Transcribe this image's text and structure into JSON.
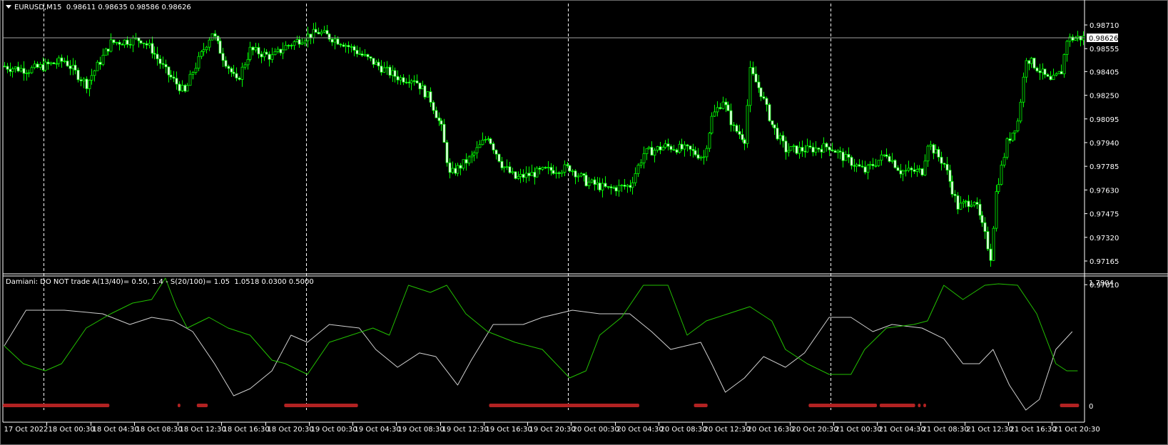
{
  "header": {
    "symbol": "EURUSD,M15",
    "ohlc": "0.98611 0.98635 0.98586 0.98626"
  },
  "indicator": {
    "label": "Damiani: DO NOT trade A(13/40)= 0.50, 1.4 - S(20/100)= 1.05  1.0518 0.0300 0.5000",
    "max_label": "1.7904",
    "zero_label": "0"
  },
  "colors": {
    "candle": "#00ff00",
    "bear_body": "#ffffff",
    "bull_body": "#000000",
    "green_line": "#22c000",
    "white_line": "#d0d0d0",
    "signal": "#b22222",
    "grid": "#c0c0c0"
  },
  "chart_data": {
    "type": "candlestick",
    "bars": 396,
    "timeframe": "M15",
    "price_axis": {
      "range": [
        0.9701,
        0.9871
      ],
      "ticks": [
        "0.98710",
        "0.98555",
        "0.98405",
        "0.98250",
        "0.98095",
        "0.97940",
        "0.97785",
        "0.97630",
        "0.97475",
        "0.97320",
        "0.97165",
        "0.97010"
      ],
      "current": "0.98626"
    },
    "time_axis": {
      "every_bars": 16,
      "labels": [
        "17 Oct 2022",
        "18 Oct 00:30",
        "18 Oct 04:30",
        "18 Oct 08:30",
        "18 Oct 12:30",
        "18 Oct 16:30",
        "18 Oct 20:30",
        "19 Oct 00:30",
        "19 Oct 04:30",
        "19 Oct 08:30",
        "19 Oct 12:30",
        "19 Oct 16:30",
        "19 Oct 20:30",
        "20 Oct 00:30",
        "20 Oct 04:30",
        "20 Oct 08:30",
        "20 Oct 12:30",
        "20 Oct 16:30",
        "20 Oct 20:30",
        "21 Oct 00:30",
        "21 Oct 04:30",
        "21 Oct 08:30",
        "21 Oct 12:30",
        "21 Oct 16:30",
        "21 Oct 20:30"
      ]
    },
    "day_separators_bar": [
      14,
      110,
      206,
      302
    ],
    "close_keypoints": [
      [
        0,
        0.9844
      ],
      [
        2,
        0.9843
      ],
      [
        9,
        0.98416
      ],
      [
        22,
        0.98477
      ],
      [
        30,
        0.98322
      ],
      [
        39,
        0.98593
      ],
      [
        50,
        0.98617
      ],
      [
        54,
        0.98547
      ],
      [
        59,
        0.98406
      ],
      [
        66,
        0.98266
      ],
      [
        69,
        0.98406
      ],
      [
        76,
        0.98663
      ],
      [
        80,
        0.985
      ],
      [
        85,
        0.98336
      ],
      [
        90,
        0.98547
      ],
      [
        98,
        0.985
      ],
      [
        103,
        0.9857
      ],
      [
        111,
        0.9864
      ],
      [
        115,
        0.98663
      ],
      [
        124,
        0.98593
      ],
      [
        132,
        0.985
      ],
      [
        140,
        0.98406
      ],
      [
        145,
        0.9836
      ],
      [
        150,
        0.9836
      ],
      [
        156,
        0.9822
      ],
      [
        160,
        0.98033
      ],
      [
        163,
        0.97729
      ],
      [
        171,
        0.97846
      ],
      [
        177,
        0.97986
      ],
      [
        182,
        0.97799
      ],
      [
        187,
        0.97706
      ],
      [
        197,
        0.97753
      ],
      [
        207,
        0.97776
      ],
      [
        213,
        0.97683
      ],
      [
        221,
        0.97636
      ],
      [
        229,
        0.97659
      ],
      [
        234,
        0.97869
      ],
      [
        242,
        0.97916
      ],
      [
        250,
        0.97893
      ],
      [
        256,
        0.97846
      ],
      [
        259,
        0.98103
      ],
      [
        263,
        0.9822
      ],
      [
        267,
        0.98033
      ],
      [
        271,
        0.97963
      ],
      [
        273,
        0.98406
      ],
      [
        277,
        0.98266
      ],
      [
        281,
        0.98056
      ],
      [
        286,
        0.97893
      ],
      [
        294,
        0.97893
      ],
      [
        302,
        0.97916
      ],
      [
        307,
        0.97846
      ],
      [
        315,
        0.97753
      ],
      [
        323,
        0.97869
      ],
      [
        328,
        0.97753
      ],
      [
        336,
        0.97753
      ],
      [
        338,
        0.9794
      ],
      [
        344,
        0.97799
      ],
      [
        349,
        0.97519
      ],
      [
        355,
        0.97566
      ],
      [
        359,
        0.97332
      ],
      [
        361,
        0.97192
      ],
      [
        363,
        0.97613
      ],
      [
        367,
        0.9794
      ],
      [
        371,
        0.9808
      ],
      [
        374,
        0.985
      ],
      [
        378,
        0.9843
      ],
      [
        383,
        0.98336
      ],
      [
        387,
        0.98406
      ],
      [
        389,
        0.98617
      ],
      [
        393,
        0.98626
      ],
      [
        395,
        0.98626
      ]
    ],
    "indicator_range": [
      0,
      1.7904
    ],
    "green_line": [
      [
        0,
        0.864
      ],
      [
        7,
        0.607
      ],
      [
        15,
        0.504
      ],
      [
        21,
        0.607
      ],
      [
        30,
        1.122
      ],
      [
        39,
        1.327
      ],
      [
        47,
        1.482
      ],
      [
        54,
        1.533
      ],
      [
        59,
        1.842
      ],
      [
        63,
        1.43
      ],
      [
        67,
        1.122
      ],
      [
        75,
        1.276
      ],
      [
        82,
        1.122
      ],
      [
        90,
        1.019
      ],
      [
        98,
        0.659
      ],
      [
        103,
        0.607
      ],
      [
        111,
        0.453
      ],
      [
        119,
        0.916
      ],
      [
        127,
        1.019
      ],
      [
        135,
        1.122
      ],
      [
        141,
        1.019
      ],
      [
        148,
        1.739
      ],
      [
        156,
        1.636
      ],
      [
        162,
        1.739
      ],
      [
        169,
        1.327
      ],
      [
        177,
        1.07
      ],
      [
        187,
        0.916
      ],
      [
        197,
        0.813
      ],
      [
        207,
        0.401
      ],
      [
        213,
        0.504
      ],
      [
        218,
        1.019
      ],
      [
        226,
        1.276
      ],
      [
        234,
        1.739
      ],
      [
        243,
        1.739
      ],
      [
        250,
        1.019
      ],
      [
        257,
        1.224
      ],
      [
        265,
        1.327
      ],
      [
        273,
        1.43
      ],
      [
        281,
        1.224
      ],
      [
        286,
        0.813
      ],
      [
        294,
        0.607
      ],
      [
        302,
        0.453
      ],
      [
        310,
        0.453
      ],
      [
        315,
        0.813
      ],
      [
        323,
        1.122
      ],
      [
        333,
        1.173
      ],
      [
        338,
        1.224
      ],
      [
        344,
        1.739
      ],
      [
        351,
        1.533
      ],
      [
        359,
        1.739
      ],
      [
        364,
        1.76
      ],
      [
        371,
        1.739
      ],
      [
        378,
        1.327
      ],
      [
        385,
        0.607
      ],
      [
        389,
        0.504
      ],
      [
        393,
        0.504
      ]
    ],
    "white_line": [
      [
        0,
        0.864
      ],
      [
        8,
        1.379
      ],
      [
        22,
        1.379
      ],
      [
        36,
        1.327
      ],
      [
        46,
        1.173
      ],
      [
        54,
        1.276
      ],
      [
        62,
        1.224
      ],
      [
        69,
        1.07
      ],
      [
        77,
        0.607
      ],
      [
        84,
        0.144
      ],
      [
        90,
        0.247
      ],
      [
        98,
        0.504
      ],
      [
        105,
        1.019
      ],
      [
        111,
        0.916
      ],
      [
        119,
        1.173
      ],
      [
        130,
        1.122
      ],
      [
        136,
        0.813
      ],
      [
        144,
        0.556
      ],
      [
        152,
        0.762
      ],
      [
        158,
        0.71
      ],
      [
        166,
        0.298
      ],
      [
        171,
        0.659
      ],
      [
        179,
        1.173
      ],
      [
        190,
        1.173
      ],
      [
        197,
        1.276
      ],
      [
        208,
        1.379
      ],
      [
        218,
        1.327
      ],
      [
        229,
        1.327
      ],
      [
        237,
        1.07
      ],
      [
        244,
        0.813
      ],
      [
        255,
        0.916
      ],
      [
        259,
        0.607
      ],
      [
        264,
        0.195
      ],
      [
        271,
        0.401
      ],
      [
        278,
        0.71
      ],
      [
        286,
        0.556
      ],
      [
        293,
        0.762
      ],
      [
        302,
        1.276
      ],
      [
        310,
        1.276
      ],
      [
        318,
        1.07
      ],
      [
        325,
        1.173
      ],
      [
        336,
        1.122
      ],
      [
        344,
        0.968
      ],
      [
        351,
        0.607
      ],
      [
        357,
        0.607
      ],
      [
        362,
        0.813
      ],
      [
        368,
        0.298
      ],
      [
        374,
        -0.062
      ],
      [
        379,
        0.093
      ],
      [
        385,
        0.813
      ],
      [
        391,
        1.07
      ]
    ],
    "no_trade_bars": [
      [
        0,
        38
      ],
      [
        64,
        64
      ],
      [
        71,
        74
      ],
      [
        103,
        129
      ],
      [
        178,
        232
      ],
      [
        253,
        257
      ],
      [
        295,
        319
      ],
      [
        321,
        333
      ],
      [
        335,
        335
      ],
      [
        337,
        337
      ],
      [
        387,
        393
      ]
    ]
  }
}
